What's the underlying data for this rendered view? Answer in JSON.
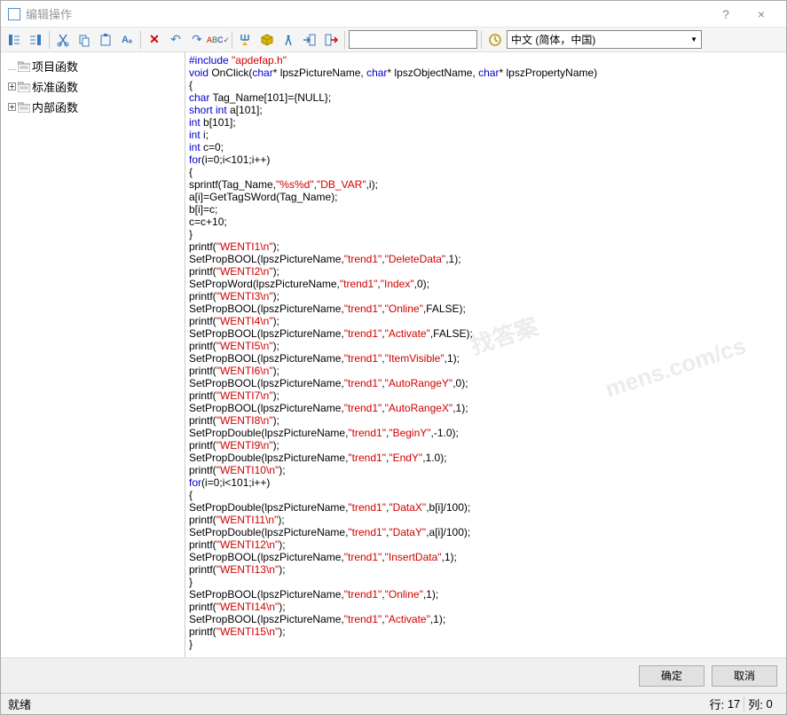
{
  "window": {
    "title": "编辑操作",
    "help": "?",
    "close": "×"
  },
  "toolbar": {
    "language": "中文 (简体，中国)"
  },
  "tree": {
    "items": [
      {
        "expand": "",
        "label": "项目函数"
      },
      {
        "expand": "+",
        "label": "标准函数"
      },
      {
        "expand": "+",
        "label": "内部函数"
      }
    ]
  },
  "code": {
    "lines": [
      [
        {
          "c": "kw",
          "t": "#include"
        },
        {
          "t": " "
        },
        {
          "c": "str",
          "t": "\"apdefap.h\""
        }
      ],
      [
        {
          "c": "kw",
          "t": "void"
        },
        {
          "t": " OnClick("
        },
        {
          "c": "kw",
          "t": "char"
        },
        {
          "t": "* lpszPictureName, "
        },
        {
          "c": "kw",
          "t": "char"
        },
        {
          "t": "* lpszObjectName, "
        },
        {
          "c": "kw",
          "t": "char"
        },
        {
          "t": "* lpszPropertyName)"
        }
      ],
      [
        {
          "t": "{"
        }
      ],
      [
        {
          "c": "kw",
          "t": "char"
        },
        {
          "t": " Tag_Name[101]={NULL};"
        }
      ],
      [
        {
          "c": "kw",
          "t": "short int"
        },
        {
          "t": " a[101];"
        }
      ],
      [
        {
          "c": "kw",
          "t": "int"
        },
        {
          "t": " b[101];"
        }
      ],
      [
        {
          "c": "kw",
          "t": "int"
        },
        {
          "t": " i;"
        }
      ],
      [
        {
          "c": "kw",
          "t": "int"
        },
        {
          "t": " c=0;"
        }
      ],
      [
        {
          "c": "kw",
          "t": "for"
        },
        {
          "t": "(i=0;i<101;i++)"
        }
      ],
      [
        {
          "t": "{"
        }
      ],
      [
        {
          "t": "sprintf(Tag_Name,"
        },
        {
          "c": "str",
          "t": "\"%s%d\""
        },
        {
          "t": ","
        },
        {
          "c": "str",
          "t": "\"DB_VAR\""
        },
        {
          "t": ",i);"
        }
      ],
      [
        {
          "t": "a[i]=GetTagSWord(Tag_Name);"
        }
      ],
      [
        {
          "t": "b[i]=c;"
        }
      ],
      [
        {
          "t": "c=c+10;"
        }
      ],
      [
        {
          "t": "}"
        }
      ],
      [
        {
          "t": "printf("
        },
        {
          "c": "str",
          "t": "\"WENTI1\\n\""
        },
        {
          "t": ");"
        }
      ],
      [
        {
          "t": "SetPropBOOL(lpszPictureName,"
        },
        {
          "c": "str",
          "t": "\"trend1\""
        },
        {
          "t": ","
        },
        {
          "c": "str",
          "t": "\"DeleteData\""
        },
        {
          "t": ",1);"
        }
      ],
      [
        {
          "t": "printf("
        },
        {
          "c": "str",
          "t": "\"WENTI2\\n\""
        },
        {
          "t": ");"
        }
      ],
      [
        {
          "t": "SetPropWord(lpszPictureName,"
        },
        {
          "c": "str",
          "t": "\"trend1\""
        },
        {
          "t": ","
        },
        {
          "c": "str",
          "t": "\"Index\""
        },
        {
          "t": ",0);"
        }
      ],
      [
        {
          "t": "printf("
        },
        {
          "c": "str",
          "t": "\"WENTI3\\n\""
        },
        {
          "t": ");"
        }
      ],
      [
        {
          "t": "SetPropBOOL(lpszPictureName,"
        },
        {
          "c": "str",
          "t": "\"trend1\""
        },
        {
          "t": ","
        },
        {
          "c": "str",
          "t": "\"Online\""
        },
        {
          "t": ",FALSE);"
        }
      ],
      [
        {
          "t": "printf("
        },
        {
          "c": "str",
          "t": "\"WENTI4\\n\""
        },
        {
          "t": ");"
        }
      ],
      [
        {
          "t": "SetPropBOOL(lpszPictureName,"
        },
        {
          "c": "str",
          "t": "\"trend1\""
        },
        {
          "t": ","
        },
        {
          "c": "str",
          "t": "\"Activate\""
        },
        {
          "t": ",FALSE);"
        }
      ],
      [
        {
          "t": "printf("
        },
        {
          "c": "str",
          "t": "\"WENTI5\\n\""
        },
        {
          "t": ");"
        }
      ],
      [
        {
          "t": "SetPropBOOL(lpszPictureName,"
        },
        {
          "c": "str",
          "t": "\"trend1\""
        },
        {
          "t": ","
        },
        {
          "c": "str",
          "t": "\"ItemVisible\""
        },
        {
          "t": ",1);"
        }
      ],
      [
        {
          "t": "printf("
        },
        {
          "c": "str",
          "t": "\"WENTI6\\n\""
        },
        {
          "t": ");"
        }
      ],
      [
        {
          "t": "SetPropBOOL(lpszPictureName,"
        },
        {
          "c": "str",
          "t": "\"trend1\""
        },
        {
          "t": ","
        },
        {
          "c": "str",
          "t": "\"AutoRangeY\""
        },
        {
          "t": ",0);"
        }
      ],
      [
        {
          "t": "printf("
        },
        {
          "c": "str",
          "t": "\"WENTI7\\n\""
        },
        {
          "t": ");"
        }
      ],
      [
        {
          "t": "SetPropBOOL(lpszPictureName,"
        },
        {
          "c": "str",
          "t": "\"trend1\""
        },
        {
          "t": ","
        },
        {
          "c": "str",
          "t": "\"AutoRangeX\""
        },
        {
          "t": ",1);"
        }
      ],
      [
        {
          "t": "printf("
        },
        {
          "c": "str",
          "t": "\"WENTI8\\n\""
        },
        {
          "t": ");"
        }
      ],
      [
        {
          "t": "SetPropDouble(lpszPictureName,"
        },
        {
          "c": "str",
          "t": "\"trend1\""
        },
        {
          "t": ","
        },
        {
          "c": "str",
          "t": "\"BeginY\""
        },
        {
          "t": ",-1.0);"
        }
      ],
      [
        {
          "t": "printf("
        },
        {
          "c": "str",
          "t": "\"WENTI9\\n\""
        },
        {
          "t": ");"
        }
      ],
      [
        {
          "t": "SetPropDouble(lpszPictureName,"
        },
        {
          "c": "str",
          "t": "\"trend1\""
        },
        {
          "t": ","
        },
        {
          "c": "str",
          "t": "\"EndY\""
        },
        {
          "t": ",1.0);"
        }
      ],
      [
        {
          "t": "printf("
        },
        {
          "c": "str",
          "t": "\"WENTI10\\n\""
        },
        {
          "t": ");"
        }
      ],
      [
        {
          "c": "kw",
          "t": "for"
        },
        {
          "t": "(i=0;i<101;i++)"
        }
      ],
      [
        {
          "t": "{"
        }
      ],
      [
        {
          "t": "SetPropDouble(lpszPictureName,"
        },
        {
          "c": "str",
          "t": "\"trend1\""
        },
        {
          "t": ","
        },
        {
          "c": "str",
          "t": "\"DataX\""
        },
        {
          "t": ",b[i]/100);"
        }
      ],
      [
        {
          "t": "printf("
        },
        {
          "c": "str",
          "t": "\"WENTI11\\n\""
        },
        {
          "t": ");"
        }
      ],
      [
        {
          "t": "SetPropDouble(lpszPictureName,"
        },
        {
          "c": "str",
          "t": "\"trend1\""
        },
        {
          "t": ","
        },
        {
          "c": "str",
          "t": "\"DataY\""
        },
        {
          "t": ",a[i]/100);"
        }
      ],
      [
        {
          "t": "printf("
        },
        {
          "c": "str",
          "t": "\"WENTI12\\n\""
        },
        {
          "t": ");"
        }
      ],
      [
        {
          "t": "SetPropBOOL(lpszPictureName,"
        },
        {
          "c": "str",
          "t": "\"trend1\""
        },
        {
          "t": ","
        },
        {
          "c": "str",
          "t": "\"InsertData\""
        },
        {
          "t": ",1);"
        }
      ],
      [
        {
          "t": "printf("
        },
        {
          "c": "str",
          "t": "\"WENTI13\\n\""
        },
        {
          "t": ");"
        }
      ],
      [
        {
          "t": "}"
        }
      ],
      [
        {
          "t": "SetPropBOOL(lpszPictureName,"
        },
        {
          "c": "str",
          "t": "\"trend1\""
        },
        {
          "t": ","
        },
        {
          "c": "str",
          "t": "\"Online\""
        },
        {
          "t": ",1);"
        }
      ],
      [
        {
          "t": "printf("
        },
        {
          "c": "str",
          "t": "\"WENTI14\\n\""
        },
        {
          "t": ");"
        }
      ],
      [
        {
          "t": "SetPropBOOL(lpszPictureName,"
        },
        {
          "c": "str",
          "t": "\"trend1\""
        },
        {
          "t": ","
        },
        {
          "c": "str",
          "t": "\"Activate\""
        },
        {
          "t": ",1);"
        }
      ],
      [
        {
          "t": "printf("
        },
        {
          "c": "str",
          "t": "\"WENTI15\\n\""
        },
        {
          "t": ");"
        }
      ],
      [
        {
          "t": "}"
        }
      ]
    ]
  },
  "buttons": {
    "ok": "确定",
    "cancel": "取消"
  },
  "status": {
    "ready": "就绪",
    "line_label": "行:",
    "line_value": "17",
    "col_label": "列:",
    "col_value": "0"
  }
}
